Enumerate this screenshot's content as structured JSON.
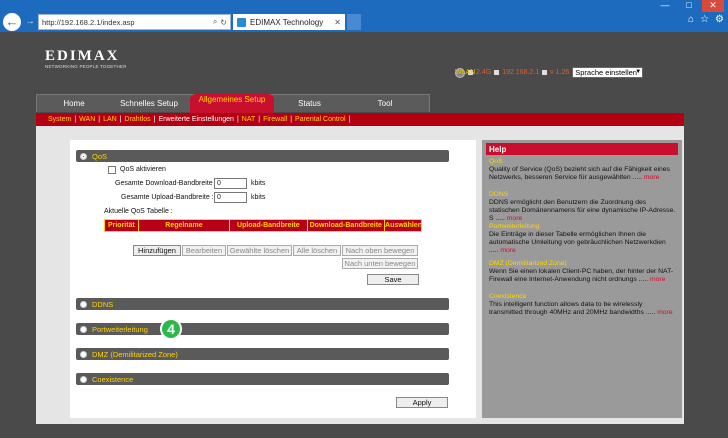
{
  "browser": {
    "url": "http://192.168.2.1/index.asp",
    "tab_title": "EDIMAX Technology",
    "win_min": "—",
    "win_max": "□",
    "win_close": "✕",
    "icons": [
      "back-icon",
      "forward-icon",
      "search-icon",
      "refresh-icon",
      "home-icon",
      "star-icon",
      "gear-icon"
    ]
  },
  "logo": {
    "brand": "EDIMAX",
    "tagline": "NETWORKING PEOPLE TOGETHER"
  },
  "status": {
    "wlan_label": "WLAN",
    "wlan_value": "2.4G",
    "ip": "192.168.2.1",
    "version": "v 1.26",
    "language": "Sprache einstellen"
  },
  "tabs": [
    "Home",
    "Schnelles Setup",
    "Allgemeines Setup",
    "Status",
    "Tool"
  ],
  "subnav": [
    "System",
    "WAN",
    "LAN",
    "Drahtlos",
    "Erweiterte Einstellungen",
    "NAT",
    "Firewall",
    "Parental Control"
  ],
  "qos": {
    "title": "QoS",
    "enable_label": "QoS aktivieren",
    "download_label": "Gesamte Download-Bandbreite :",
    "download_value": "0",
    "upload_label": "Gesamte Upload-Bandbreite :",
    "upload_value": "0",
    "unit": "kbits",
    "table_label": "Aktuelle QoS Tabelle :",
    "columns": [
      "Priorität",
      "Regelname",
      "Upload-Bandbreite",
      "Download-Bandbreite",
      "Auswählen"
    ],
    "buttons": {
      "add": "Hinzufügen",
      "edit": "Bearbeiten",
      "delete_selected": "Gewählte löschen",
      "delete_all": "Alle löschen",
      "move_up": "Nach oben bewegen",
      "move_down": "Nach unten bewegen",
      "save": "Save"
    }
  },
  "sections": [
    "DDNS",
    "Portweiterleitung",
    "DMZ (Demilitarized Zone)",
    "Coexistence"
  ],
  "apply_label": "Apply",
  "badge": "4",
  "help": {
    "title": "Help",
    "more": "more",
    "items": [
      {
        "title": "QoS",
        "text": "Quality of Service (QoS) bezieht sich auf die Fähigkeit eines Netzwerks, besseren Service für ausgewählten ....."
      },
      {
        "title": "DDNS",
        "text": "DDNS ermöglicht den Benutzern die Zuordnung des statischen Domänennamens für eine dynamische IP-Adresse. S ....."
      },
      {
        "title": "Portweiterleitung",
        "text": "Die Einträge in dieser Tabelle ermöglichen Ihnen die automatische Umleitung von gebräuchlichen Netzwerkdien ....."
      },
      {
        "title": "DMZ (Demilitarized Zone)",
        "text": "Wenn Sie einen lokalen Client-PC haben, der hinter der NAT-Firewall eine Internet-Anwendung nicht ordnungs ....."
      },
      {
        "title": "Coexistence",
        "text": "This intelligent function allows data to be wirelessly transmitted through 40MHz and 20MHz bandwidths ....."
      }
    ]
  }
}
